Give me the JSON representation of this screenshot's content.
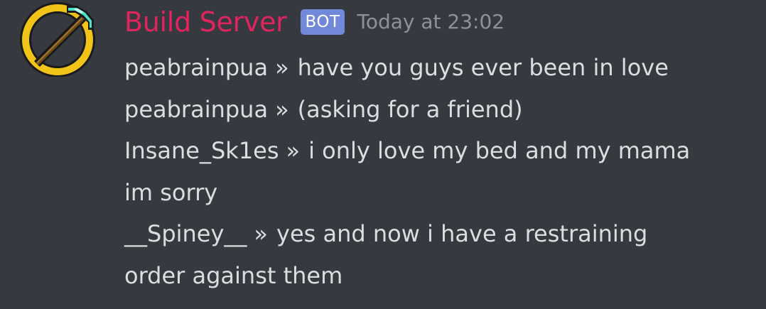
{
  "message": {
    "author": "Build Server",
    "badge": "BOT",
    "timestamp": "Today at 23:02",
    "author_color": "#e0245e",
    "badge_color": "#7289da",
    "avatar_icon": "diamond-pickaxe-no-sign-icon",
    "separator": "»",
    "lines": [
      {
        "user": "peabrainpua",
        "text": "have you guys ever been in love"
      },
      {
        "user": "peabrainpua",
        "text": "(asking for a friend)"
      },
      {
        "user": "Insane_Sk1es",
        "text": "i only love my bed and my mama"
      },
      {
        "user": "",
        "text": "im sorry"
      },
      {
        "user": "__Spiney__",
        "text": "yes and now i have a restraining"
      },
      {
        "user": "",
        "text": "order against them"
      }
    ]
  }
}
